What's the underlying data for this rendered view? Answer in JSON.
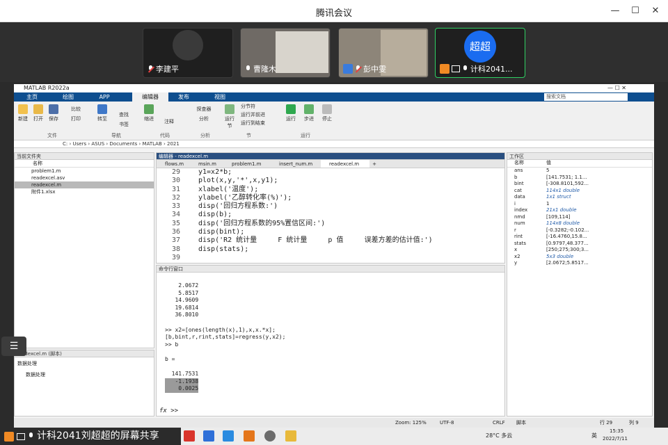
{
  "window": {
    "title": "腾讯会议"
  },
  "participants": [
    {
      "name": "李建平",
      "mic": "off"
    },
    {
      "name": "曹隆木",
      "mic": "on"
    },
    {
      "name": "彭中雯",
      "mic": "off"
    },
    {
      "name": "计科2041...",
      "mic": "on",
      "avatar": "超超"
    }
  ],
  "matlab": {
    "title": "MATLAB R2022a",
    "tabs": [
      "主页",
      "绘图",
      "APP",
      "编辑器",
      "发布",
      "视图"
    ],
    "search_placeholder": "搜索文档",
    "path": "C: › Users › ASUS › Documents › MATLAB › 2021",
    "ribbon_buttons": [
      "新建",
      "打开",
      "保存",
      "比较",
      "打印",
      "转至",
      "查找",
      "书签",
      "缩进",
      "注释",
      "探查器",
      "分析",
      "运行节",
      "分节符",
      "运行并前进",
      "运行到结束",
      "运行",
      "步进",
      "停止"
    ],
    "ribbon_groups": [
      "文件",
      "导航",
      "代码",
      "分析",
      "节",
      "运行"
    ],
    "file_panel": {
      "title": "当前文件夹",
      "header": "名称",
      "files": [
        "problem1.m",
        "readexcel.asv",
        "readexcel.m",
        "附件1.xlsx"
      ]
    },
    "detail_panel": {
      "title": "readexcel.m (脚本)",
      "items": [
        "数据处理",
        "数据处理"
      ]
    },
    "editor": {
      "title": "编辑器 - readexcel.m",
      "tabs": [
        "flows.m",
        "msin.m",
        "problem1.m",
        "insert_num.m",
        "readexcel.m"
      ],
      "lines": [
        {
          "n": "29",
          "code": "y1=x2*b;"
        },
        {
          "n": "30",
          "code": "plot(x,y,'*',x,y1);"
        },
        {
          "n": "31",
          "code": "xlabel('温度');"
        },
        {
          "n": "32",
          "code": "ylabel('乙醇转化率(%)');"
        },
        {
          "n": "33",
          "code": "disp('回归方程系数:')"
        },
        {
          "n": "34",
          "code": "disp(b);"
        },
        {
          "n": "35",
          "code": "disp('回归方程系数的95%置信区间:')"
        },
        {
          "n": "36",
          "code": "disp(bint);"
        },
        {
          "n": "37",
          "code": "disp('R2 统计量     F 统计量     p 值     误差方差的估计值:')"
        },
        {
          "n": "38",
          "code": "disp(stats);"
        },
        {
          "n": "39",
          "code": ""
        }
      ]
    },
    "command_window": {
      "title": "命令行窗口",
      "lines": [
        "    2.0672",
        "    5.8517",
        "   14.9609",
        "   19.6814",
        "   36.8010",
        "",
        ">> x2=[ones(length(x),1),x,x.*x];",
        "[b,bint,r,rint,stats]=regress(y,x2);",
        ">> b",
        "",
        "b =",
        "",
        "  141.7531",
        "   -1.1938",
        "    0.0025"
      ],
      "prompt": ">>"
    },
    "workspace": {
      "title": "工作区",
      "col_name": "名称",
      "col_value": "值",
      "vars": [
        {
          "name": "ans",
          "value": "5"
        },
        {
          "name": "b",
          "value": "[141.7531; 1.1..."
        },
        {
          "name": "bint",
          "value": "[-308.8101,592..."
        },
        {
          "name": "cat",
          "value": "114x1 double"
        },
        {
          "name": "data",
          "value": "1x1 struct"
        },
        {
          "name": "i",
          "value": "1"
        },
        {
          "name": "index",
          "value": "21x1 double"
        },
        {
          "name": "nmd",
          "value": "[109,114]"
        },
        {
          "name": "num",
          "value": "114x8 double"
        },
        {
          "name": "r",
          "value": "[-0.3282;-0.102..."
        },
        {
          "name": "rint",
          "value": "[-16.4760,15.8..."
        },
        {
          "name": "stats",
          "value": "[0.9797,48.377..."
        },
        {
          "name": "x",
          "value": "[250;275;300;3..."
        },
        {
          "name": "x2",
          "value": "5x3 double"
        },
        {
          "name": "y",
          "value": "[2.0672;5.8517..."
        }
      ]
    },
    "statusbar": {
      "zoom": "Zoom: 125%",
      "encoding": "UTF-8",
      "eol": "CRLF",
      "type": "脚本",
      "row": "行 29",
      "col": "列 9"
    }
  },
  "taskbar": {
    "share_label": "计科2041刘超超的屏幕共享",
    "weather": "28°C 多云",
    "ime": "英",
    "time": "15:35",
    "date": "2022/7/11"
  }
}
